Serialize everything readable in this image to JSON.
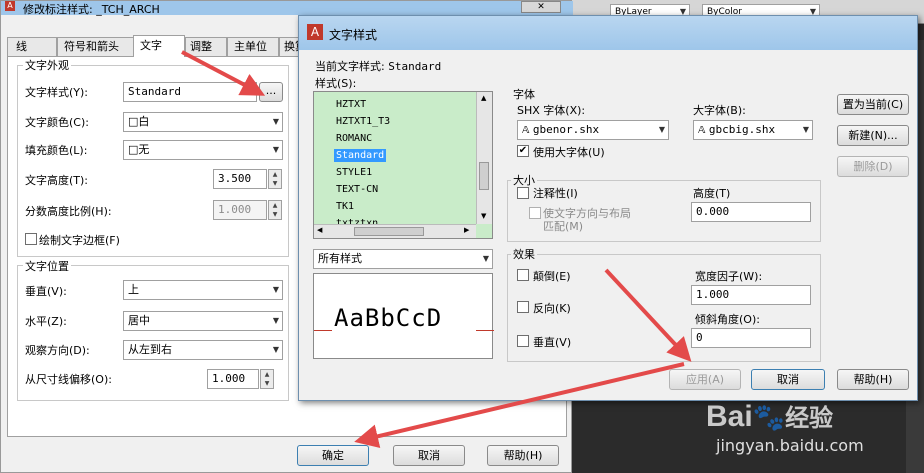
{
  "back_dialog": {
    "title": "修改标注样式: _TCH_ARCH",
    "tabs": [
      "线",
      "符号和箭头",
      "文字",
      "调整",
      "主单位",
      "换算"
    ],
    "text_appearance": {
      "group_title": "文字外观",
      "style_label": "文字样式(Y):",
      "style_value": "Standard",
      "style_btn": "...",
      "color_label": "文字颜色(C):",
      "color_value": "□白",
      "fill_label": "填充颜色(L):",
      "fill_value": "□无",
      "height_label": "文字高度(T):",
      "height_value": "3.500",
      "fraction_label": "分数高度比例(H):",
      "fraction_value": "1.000",
      "frame_label": "绘制文字边框(F)"
    },
    "text_position": {
      "group_title": "文字位置",
      "vertical_label": "垂直(V):",
      "vertical_value": "上",
      "horizontal_label": "水平(Z):",
      "horizontal_value": "居中",
      "view_label": "观察方向(D):",
      "view_value": "从左到右",
      "offset_label": "从尺寸线偏移(O):",
      "offset_value": "1.000"
    },
    "buttons": {
      "ok": "确定",
      "cancel": "取消",
      "help": "帮助(H)"
    }
  },
  "toolbar": {
    "layer1": "ByLayer",
    "layer2": "ByColor"
  },
  "text_style": {
    "title": "文字样式",
    "current_label": "当前文字样式:",
    "current_value": "Standard",
    "styles_label": "样式(S):",
    "styles": [
      "HZTXT",
      "HZTXT1_T3",
      "ROMANC",
      "Standard",
      "STYLE1",
      "TEXT-CN",
      "TK1",
      "txtztxn"
    ],
    "selected_style": "Standard",
    "filter_value": "所有样式",
    "preview_text": "AaBbCcD",
    "font": {
      "group_title": "字体",
      "shx_label": "SHX 字体(X):",
      "shx_value": "gbenor.shx",
      "big_label": "大字体(B):",
      "big_value": "gbcbig.shx",
      "use_big_label": "使用大字体(U)"
    },
    "size": {
      "group_title": "大小",
      "annotative_label": "注释性(I)",
      "orient_label": "使文字方向与布局",
      "orient_label2": "匹配(M)",
      "height_label": "高度(T)",
      "height_value": "0.000"
    },
    "effects": {
      "group_title": "效果",
      "upside_label": "颠倒(E)",
      "backwards_label": "反向(K)",
      "vertical_label": "垂直(V)",
      "width_label": "宽度因子(W):",
      "width_value": "1.000",
      "oblique_label": "倾斜角度(O):",
      "oblique_value": "0"
    },
    "buttons": {
      "set_current": "置为当前(C)",
      "new": "新建(N)...",
      "delete": "删除(D)",
      "apply": "应用(A)",
      "cancel": "取消",
      "help": "帮助(H)"
    }
  },
  "watermark": {
    "logo_text": "Bai",
    "logo_text2": "经验",
    "url": "jingyan.baidu.com"
  },
  "colors": {
    "arrow": "#e34a4a",
    "dialog_bg": "#f0f0f0",
    "list_bg": "#c9ecc9",
    "title_bar": "#9ec6ea"
  }
}
